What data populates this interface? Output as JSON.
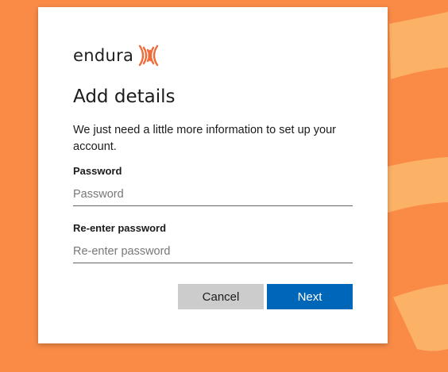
{
  "brand": {
    "name": "endura",
    "logo_icon": "endura-waves-icon",
    "accent_color": "#f06b3a"
  },
  "background": {
    "color": "#f98b47",
    "decoration_color": "#fbb66a"
  },
  "page": {
    "title": "Add details",
    "description": "We just need a little more information to set up your account."
  },
  "form": {
    "password": {
      "label": "Password",
      "placeholder": "Password",
      "value": ""
    },
    "reenter_password": {
      "label": "Re-enter password",
      "placeholder": "Re-enter password",
      "value": ""
    }
  },
  "buttons": {
    "cancel_label": "Cancel",
    "next_label": "Next",
    "next_color": "#0067b8",
    "cancel_color": "#cccccc"
  }
}
